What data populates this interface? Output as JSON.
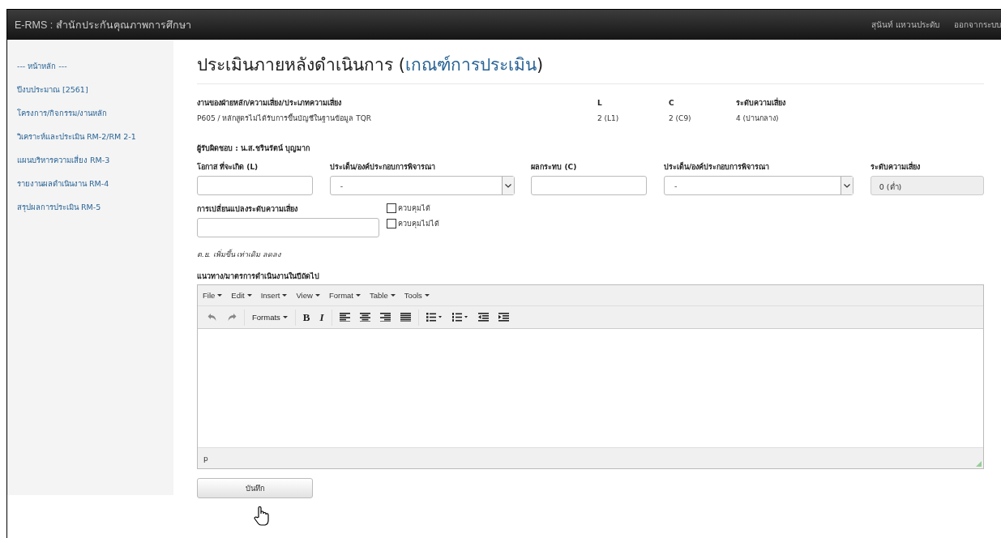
{
  "topbar": {
    "title": "E-RMS : สำนักประกันคุณภาพการศึกษา",
    "user": "สุนันท์ แหวนประดับ",
    "logout": "ออกจากระบบ"
  },
  "sidebar": {
    "items": [
      {
        "label": "--- หน้าหลัก ---"
      },
      {
        "label": "ปีงบประมาณ [2561]"
      },
      {
        "label": "โครงการ/กิจกรรม/งานหลัก"
      },
      {
        "label": "วิเคราะห์และประเมิน RM-2/RM 2-1"
      },
      {
        "label": "แผนบริหารความเสี่ยง RM-3"
      },
      {
        "label": "รายงานผลดำเนินงาน RM-4"
      },
      {
        "label": "สรุปผลการประเมิน RM-5"
      }
    ]
  },
  "page_title": {
    "before": "ประเมินภายหลังดำเนินการ (",
    "link": "เกณฑ์การประเมิน",
    "after": ")"
  },
  "summary": [
    {
      "header": "งานของฝ่ายหลัก/ความเสี่ยง/ประเภทความเสี่ยง",
      "value": "P605 / หลักสูตรไม่ได้รับการขึ้นบัญชีในฐานข้อมูล TQR"
    },
    {
      "header": "L",
      "value": "2 (L1)"
    },
    {
      "header": "C",
      "value": "2 (C9)"
    },
    {
      "header": "ระดับความเสี่ยง",
      "value": "4 (ปานกลาง)"
    }
  ],
  "responsible": "ผู้รับผิดชอบ : น.ส.ชรินรัตน์ บุญมาก",
  "fields": [
    {
      "kind": "input",
      "label": "โอกาส ที่จะเกิด (L)"
    },
    {
      "kind": "select",
      "label": "ประเด็น/องค์ประกอบการพิจารณา",
      "value": "-"
    },
    {
      "kind": "input",
      "label": "ผลกระทบ (C)"
    },
    {
      "kind": "select",
      "label": "ประเด็น/องค์ประกอบการพิจารณา",
      "value": "-"
    },
    {
      "kind": "readonly",
      "label": "ระดับความเสี่ยง",
      "value": "0 (ต่ำ)"
    }
  ],
  "change_field": {
    "label": "การเปลี่ยนแปลงระดับความเสี่ยง"
  },
  "checkboxes": [
    {
      "label": "ควบคุมได้",
      "checked": false
    },
    {
      "label": "ควบคุมไม่ได้",
      "checked": false
    }
  ],
  "hint": "ต.ย. เพิ่มขึ้น เท่าเดิม ลดลง",
  "editor": {
    "label": "แนวทาง/มาตรการดำเนินงานในปีถัดไป",
    "menus": [
      "File",
      "Edit",
      "Insert",
      "View",
      "Format",
      "Table",
      "Tools"
    ],
    "undo": {
      "disabled": true
    },
    "redo": {
      "disabled": true
    },
    "formats": "Formats",
    "bold": "B",
    "italic": "I",
    "status": "p"
  },
  "save_button": "บันทึก"
}
